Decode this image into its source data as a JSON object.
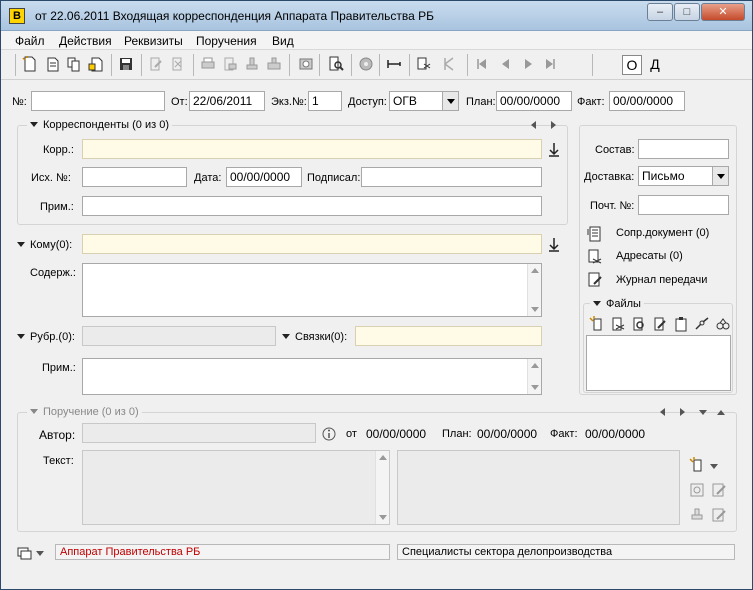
{
  "window": {
    "app_icon_letter": "B",
    "title": "от 22.06.2011 Входящая корреспонденция Аппарата Правительства РБ",
    "minimize_glyph": "–",
    "maximize_glyph": "□",
    "close_glyph": "✕"
  },
  "menu": {
    "items": [
      "Файл",
      "Действия",
      "Реквизиты",
      "Поручения",
      "Вид"
    ]
  },
  "toolbar": {
    "o_label": "О",
    "d_label": "Д"
  },
  "header": {
    "num_label": "№:",
    "num_value": "",
    "date_label": "От:",
    "date_value": "22/06/2011",
    "copy_label": "Экз.№:",
    "copy_value": "1",
    "access_label": "Доступ:",
    "access_value": "ОГВ",
    "plan_label": "План:",
    "plan_value": "00/00/0000",
    "fact_label": "Факт:",
    "fact_value": "00/00/0000"
  },
  "correspondents": {
    "title": "Корреспонденты (0 из 0)",
    "corr_label": "Корр.:",
    "corr_value": "",
    "out_num_label": "Исх. №:",
    "out_num_value": "",
    "date_label": "Дата:",
    "date_value": "00/00/0000",
    "signed_label": "Подписал:",
    "signed_value": "",
    "note_label": "Прим.:",
    "note_value": ""
  },
  "main": {
    "to_label": "Кому(0):",
    "to_value": "",
    "content_label": "Содерж.:",
    "content_value": "",
    "rubric_label": "Рубр.(0):",
    "rubric_value": "",
    "links_label": "Связки(0):",
    "links_value": "",
    "note_label": "Прим.:",
    "note_value": ""
  },
  "right_panel": {
    "composition_label": "Состав:",
    "composition_value": "",
    "delivery_label": "Доставка:",
    "delivery_value": "Письмо",
    "post_num_label": "Почт. №:",
    "post_num_value": "",
    "accompanying_doc": "Сопр.документ (0)",
    "addressees": "Адресаты (0)",
    "transfer_log": "Журнал передачи",
    "files_title": "Файлы"
  },
  "assignment": {
    "title": "Поручение (0 из 0)",
    "author_label": "Автор:",
    "author_value": "",
    "from_label": "от",
    "from_value": "00/00/0000",
    "plan_label": "План:",
    "plan_value": "00/00/0000",
    "fact_label": "Факт:",
    "fact_value": "00/00/0000",
    "text_label": "Текст:",
    "text_value": ""
  },
  "status": {
    "org": "Аппарат Правительства РБ",
    "dept": "Специалисты сектора делопроизводства",
    "org_color": "#c00000"
  }
}
